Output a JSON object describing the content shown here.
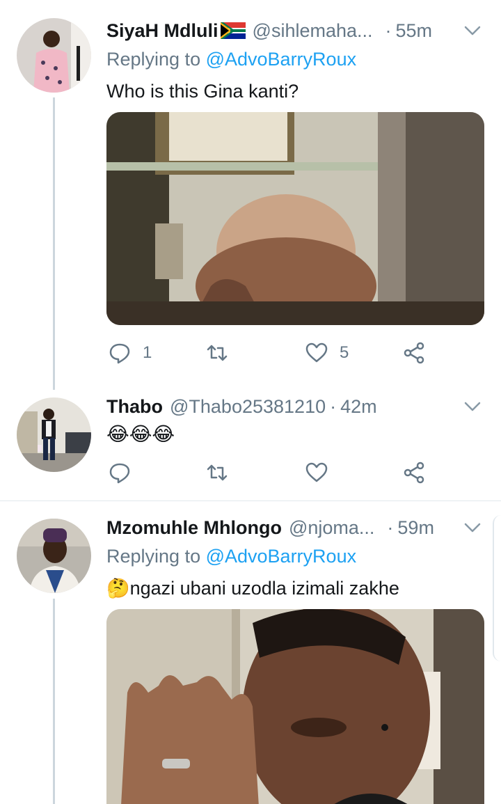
{
  "tweets": [
    {
      "name": "SiyaH Mdluli",
      "handle": "@sihlemaha...",
      "dot": "·",
      "time": "55m",
      "replying_prefix": "Replying to ",
      "replying_to": "@AdvoBarryRoux",
      "text": "Who is this Gina kanti?",
      "reply_count": "1",
      "retweet_count": "",
      "like_count": "5"
    },
    {
      "name": "Thabo",
      "handle": "@Thabo25381210",
      "dot": "·",
      "time": "42m",
      "text": "😂😂😂",
      "reply_count": "",
      "retweet_count": "",
      "like_count": ""
    },
    {
      "name": "Mzomuhle Mhlongo",
      "handle": "@njoma...",
      "dot": "·",
      "time": "59m",
      "replying_prefix": "Replying to ",
      "replying_to": "@AdvoBarryRoux",
      "text": "🤔ngazi ubani uzodla izimali zakhe"
    }
  ],
  "icons": [
    "reply-icon",
    "retweet-icon",
    "like-icon",
    "share-icon",
    "chevron-down-icon",
    "south-africa-flag-icon"
  ],
  "colors": {
    "link": "#1da1f2",
    "secondary_text": "#657786",
    "thread_line": "#ccd6dd",
    "divider": "#e1e8ed"
  }
}
